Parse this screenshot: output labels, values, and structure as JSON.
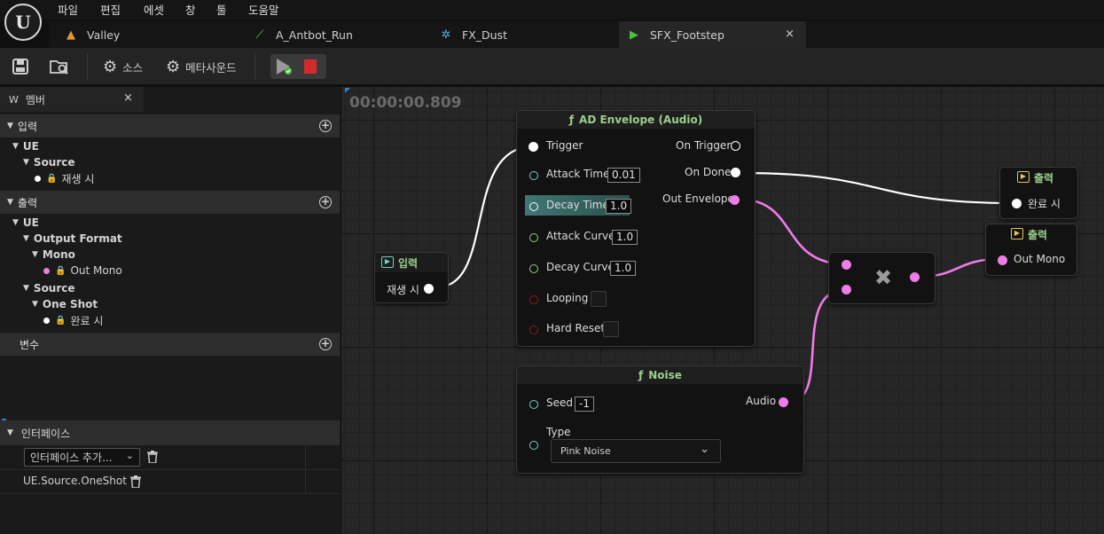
{
  "menu": [
    "파일",
    "편집",
    "에셋",
    "창",
    "툴",
    "도움말"
  ],
  "tabs": [
    {
      "label": "Valley",
      "icon": "landscape-icon"
    },
    {
      "label": "A_Antbot_Run",
      "icon": "animation-icon"
    },
    {
      "label": "FX_Dust",
      "icon": "niagara-icon"
    },
    {
      "label": "SFX_Footstep",
      "icon": "play-icon",
      "active": true,
      "close": "×"
    }
  ],
  "toolbar": {
    "source_label": "소스",
    "meta_label": "메타사운드"
  },
  "left_panel": {
    "tab_label": "멤버",
    "tab_close": "×",
    "sections": {
      "input": "입력",
      "output": "출력",
      "variables": "변수",
      "interfaces": "인터페이스"
    },
    "input_tree": {
      "ue": "UE",
      "source": "Source",
      "on_play": "재생 시"
    },
    "output_tree": {
      "ue": "UE",
      "output_format": "Output Format",
      "mono": "Mono",
      "out_mono": "Out Mono",
      "source": "Source",
      "one_shot": "One Shot",
      "on_finished": "완료 시"
    },
    "interface_add": "인터페이스 추가...",
    "interface_item": "UE.Source.OneShot"
  },
  "graph": {
    "timecode": "00:00:00.809",
    "input_node": {
      "title": "입력",
      "pin": "재생 시"
    },
    "ad_node": {
      "title": "AD Envelope (Audio)",
      "inputs": {
        "trigger": "Trigger",
        "attack_time": "Attack Time",
        "decay_time": "Decay Time",
        "attack_curve": "Attack Curve",
        "decay_curve": "Decay Curve",
        "looping": "Looping",
        "hard_reset": "Hard Reset"
      },
      "values": {
        "attack_time": "0.01",
        "decay_time": "1.0",
        "attack_curve": "1.0",
        "decay_curve": "1.0"
      },
      "outputs": {
        "on_trigger": "On Trigger",
        "on_done": "On Done",
        "out_envelope": "Out Envelope"
      }
    },
    "noise_node": {
      "title": "Noise",
      "seed": "Seed",
      "seed_value": "-1",
      "type": "Type",
      "type_value": "Pink Noise",
      "audio": "Audio"
    },
    "multiply_node": {
      "symbol": "✖"
    },
    "output_node_1": {
      "title": "출력",
      "pin": "완료 시"
    },
    "output_node_2": {
      "title": "출력",
      "pin": "Out Mono"
    }
  },
  "colors": {
    "audio_pin": "#f07ce8",
    "float_pin": "#8ed27e",
    "time_pin": "#6fd2c8",
    "bool_pin": "#8b1c1c",
    "title_green": "#9ccf8c"
  }
}
